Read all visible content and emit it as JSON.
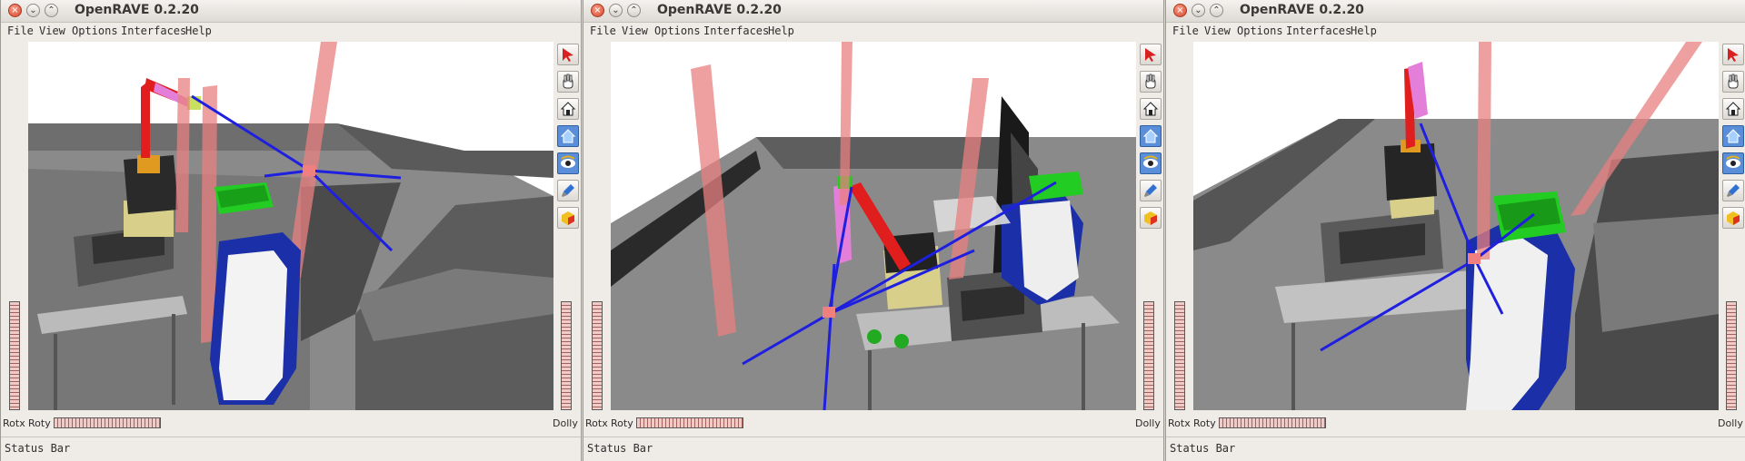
{
  "windows": [
    {
      "title": "OpenRAVE 0.2.20",
      "menu": [
        "File",
        "View",
        "Options",
        "Interfaces",
        "Help"
      ],
      "labels": {
        "rotx": "Rotx",
        "roty": "Roty",
        "dolly": "Dolly"
      },
      "status": "Status Bar"
    },
    {
      "title": "OpenRAVE 0.2.20",
      "menu": [
        "File",
        "View",
        "Options",
        "Interfaces",
        "Help"
      ],
      "labels": {
        "rotx": "Rotx",
        "roty": "Roty",
        "dolly": "Dolly"
      },
      "status": "Status Bar"
    },
    {
      "title": "OpenRAVE 0.2.20",
      "menu": [
        "File",
        "View",
        "Options",
        "Interfaces",
        "Help"
      ],
      "labels": {
        "rotx": "Rotx",
        "roty": "Roty",
        "dolly": "Dolly"
      },
      "status": "Status Bar"
    }
  ],
  "window_buttons": {
    "close": "×",
    "minimize": "⌄",
    "maximize": "⌃"
  },
  "toolbar_icons": [
    "select-arrow-icon",
    "pan-hand-icon",
    "home-view-icon",
    "home-reset-icon",
    "view-eye-icon",
    "light-icon",
    "collision-cube-icon"
  ],
  "colors": {
    "accent": "#5b8ed8",
    "pole": "#e87f7f",
    "ray": "#1f1fe0",
    "gripper_box": "#22cc22",
    "robot_blue": "#1a2fa8"
  }
}
